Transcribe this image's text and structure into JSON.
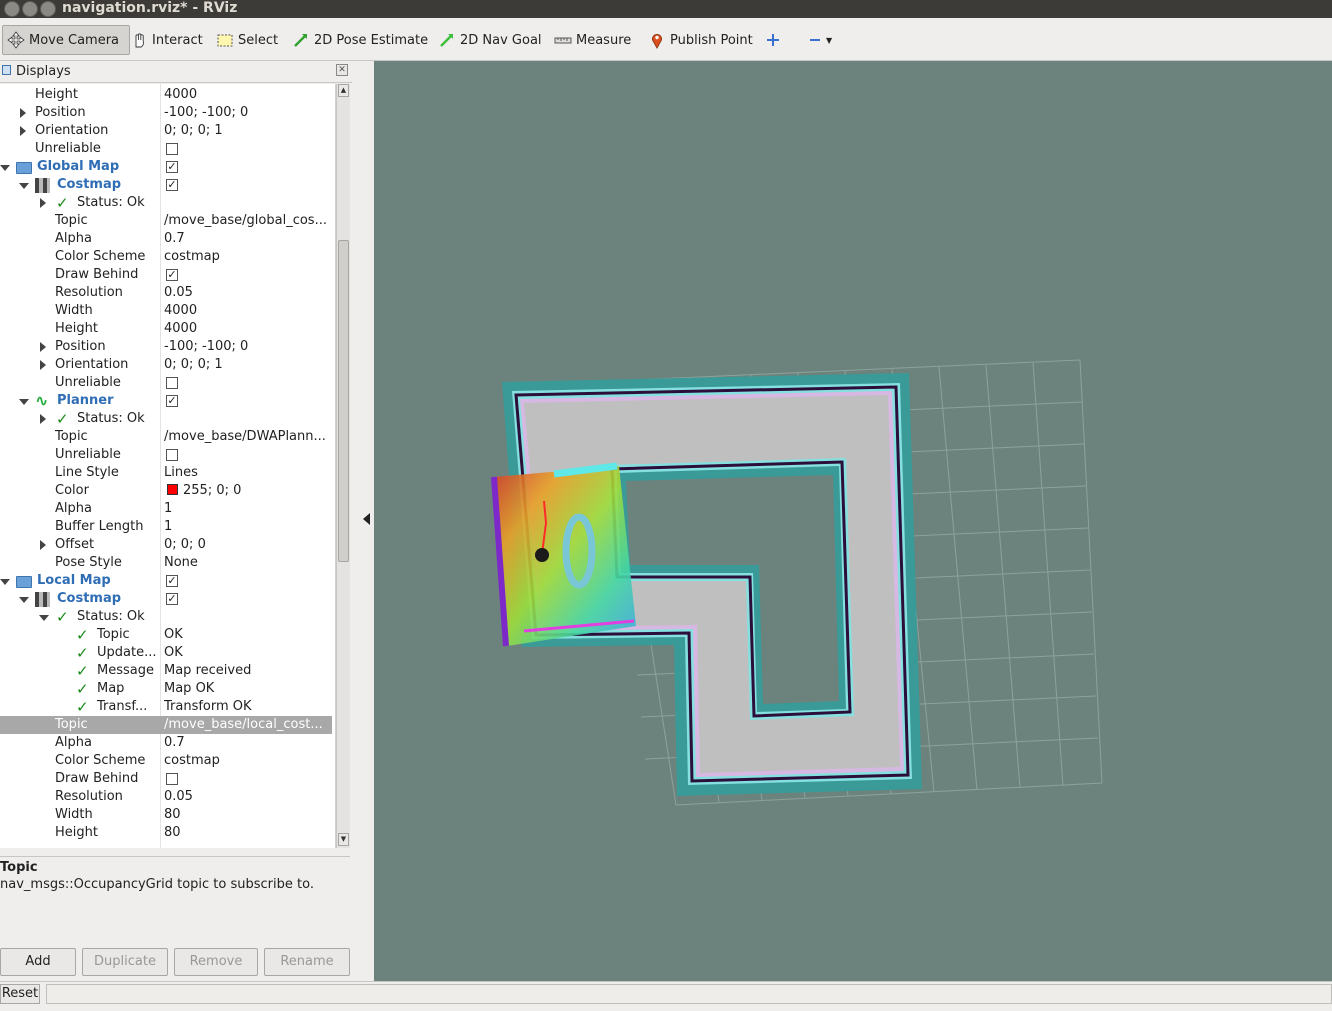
{
  "window": {
    "title": "navigation.rviz* - RViz"
  },
  "toolbar": {
    "move_camera": "Move Camera",
    "interact": "Interact",
    "select": "Select",
    "pose_estimate": "2D Pose Estimate",
    "nav_goal": "2D Nav Goal",
    "measure": "Measure",
    "publish_point": "Publish Point"
  },
  "displays": {
    "title": "Displays",
    "rows": [
      {
        "name": "Height",
        "value": "4000"
      },
      {
        "name": "Position",
        "value": "-100; -100; 0"
      },
      {
        "name": "Orientation",
        "value": "0; 0; 0; 1"
      },
      {
        "name": "Unreliable",
        "value": ""
      },
      {
        "name": "Global Map",
        "value": ""
      },
      {
        "name": "Costmap",
        "value": ""
      },
      {
        "name": "Status: Ok",
        "value": ""
      },
      {
        "name": "Topic",
        "value": "/move_base/global_cos..."
      },
      {
        "name": "Alpha",
        "value": "0.7"
      },
      {
        "name": "Color Scheme",
        "value": "costmap"
      },
      {
        "name": "Draw Behind",
        "value": ""
      },
      {
        "name": "Resolution",
        "value": "0.05"
      },
      {
        "name": "Width",
        "value": "4000"
      },
      {
        "name": "Height",
        "value": "4000"
      },
      {
        "name": "Position",
        "value": "-100; -100; 0"
      },
      {
        "name": "Orientation",
        "value": "0; 0; 0; 1"
      },
      {
        "name": "Unreliable",
        "value": ""
      },
      {
        "name": "Planner",
        "value": ""
      },
      {
        "name": "Status: Ok",
        "value": ""
      },
      {
        "name": "Topic",
        "value": "/move_base/DWAPlann..."
      },
      {
        "name": "Unreliable",
        "value": ""
      },
      {
        "name": "Line Style",
        "value": "Lines"
      },
      {
        "name": "Color",
        "value": "255; 0; 0"
      },
      {
        "name": "Alpha",
        "value": "1"
      },
      {
        "name": "Buffer Length",
        "value": "1"
      },
      {
        "name": "Offset",
        "value": "0; 0; 0"
      },
      {
        "name": "Pose Style",
        "value": "None"
      },
      {
        "name": "Local Map",
        "value": ""
      },
      {
        "name": "Costmap",
        "value": ""
      },
      {
        "name": "Status: Ok",
        "value": ""
      },
      {
        "name": "Topic",
        "value": "OK"
      },
      {
        "name": "Update...",
        "value": "OK"
      },
      {
        "name": "Message",
        "value": "Map received"
      },
      {
        "name": "Map",
        "value": "Map OK"
      },
      {
        "name": "Transf...",
        "value": "Transform OK"
      },
      {
        "name": "Topic",
        "value": "/move_base/local_cost..."
      },
      {
        "name": "Alpha",
        "value": "0.7"
      },
      {
        "name": "Color Scheme",
        "value": "costmap"
      },
      {
        "name": "Draw Behind",
        "value": ""
      },
      {
        "name": "Resolution",
        "value": "0.05"
      },
      {
        "name": "Width",
        "value": "80"
      },
      {
        "name": "Height",
        "value": "80"
      }
    ]
  },
  "description": {
    "heading": "Topic",
    "body": "nav_msgs::OccupancyGrid topic to subscribe to."
  },
  "buttons": {
    "add": "Add",
    "duplicate": "Duplicate",
    "remove": "Remove",
    "rename": "Rename"
  },
  "statusbar": {
    "reset": "Reset"
  },
  "colors": {
    "viewport_bg": "#6c837d",
    "group_label": "#2f6db5",
    "planner_color": "#ff0000"
  }
}
